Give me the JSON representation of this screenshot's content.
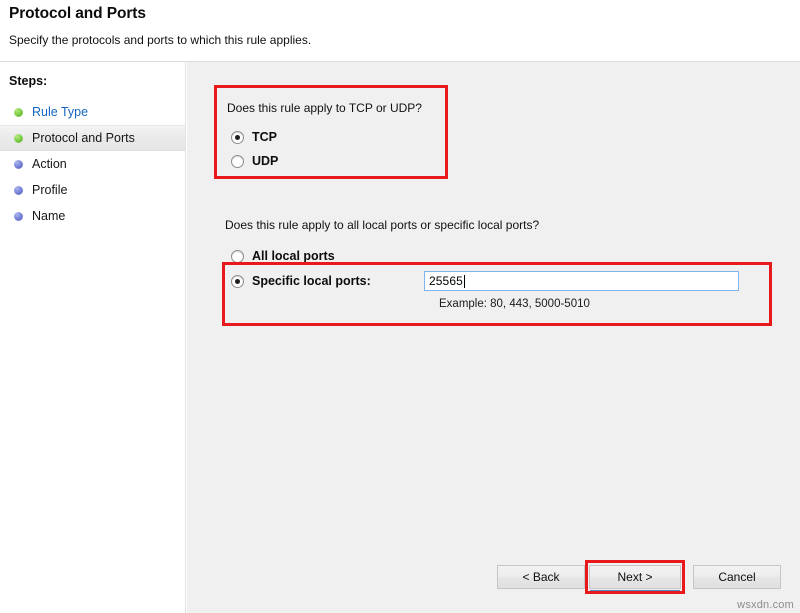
{
  "header": {
    "title": "Protocol and Ports",
    "subtitle": "Specify the protocols and ports to which this rule applies."
  },
  "sidebar": {
    "steps_label": "Steps:",
    "items": [
      {
        "label": "Rule Type",
        "bullet": "green",
        "state": "link",
        "active": false
      },
      {
        "label": "Protocol and Ports",
        "bullet": "green",
        "state": "normal",
        "active": true
      },
      {
        "label": "Action",
        "bullet": "blue",
        "state": "normal",
        "active": false
      },
      {
        "label": "Profile",
        "bullet": "blue",
        "state": "normal",
        "active": false
      },
      {
        "label": "Name",
        "bullet": "blue",
        "state": "normal",
        "active": false
      }
    ]
  },
  "protocol_section": {
    "question": "Does this rule apply to TCP or UDP?",
    "options": [
      {
        "label": "TCP",
        "selected": true
      },
      {
        "label": "UDP",
        "selected": false
      }
    ]
  },
  "ports_section": {
    "question": "Does this rule apply to all local ports or specific local ports?",
    "all_ports_label": "All local ports",
    "all_ports_selected": false,
    "specific_ports_label": "Specific local ports:",
    "specific_ports_selected": true,
    "port_value": "25565",
    "hint": "Example: 80, 443, 5000-5010"
  },
  "footer": {
    "back_label": "< Back",
    "next_label": "Next >",
    "cancel_label": "Cancel",
    "watermark": "wsxdn.com"
  },
  "annotation_color": "#e8191c"
}
